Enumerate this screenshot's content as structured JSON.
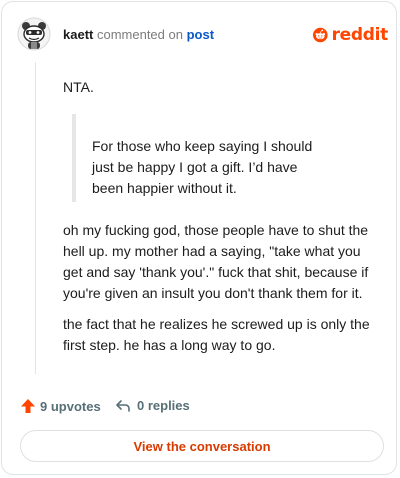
{
  "header": {
    "username": "kaett",
    "action": " commented on ",
    "post_link": "post"
  },
  "brand": {
    "logo_text": "reddit",
    "accent_color": "#ff4500"
  },
  "comment": {
    "intro": "NTA.",
    "quote": "For those who keep saying I should just be happy I got a gift. I’d have been happier without it.",
    "paragraphs": [
      "oh my fucking god, those people have to shut the hell up. my mother had a saying, \"take what you get and say 'thank you'.\" fuck that shit, because if you're given an insult you don't thank them for it.",
      "the fact that he realizes he screwed up is only the first step. he has a long way to go."
    ]
  },
  "footer": {
    "upvotes": "9 upvotes",
    "replies": "0 replies",
    "view_button": "View the conversation"
  },
  "icons": {
    "avatar": "snoo-avatar-icon",
    "logo": "reddit-alien-icon",
    "upvote": "upvote-arrow-icon",
    "reply": "reply-arrow-icon"
  }
}
